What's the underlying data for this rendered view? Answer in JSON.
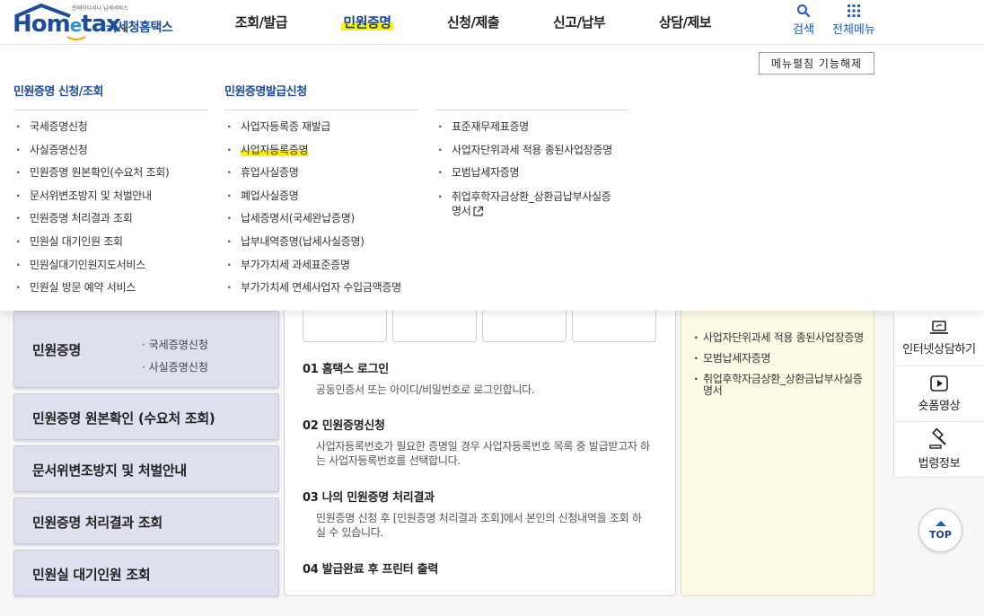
{
  "header": {
    "logo": {
      "tagline": "언제어디서나 납세서비스",
      "wordmark_home": "Hom",
      "wordmark_e": "e",
      "wordmark_tax": "tax",
      "wordmark_dot": ".",
      "subtitle": "국세청홈택스"
    },
    "nav": [
      {
        "label": "조회/발급"
      },
      {
        "label": "민원증명"
      },
      {
        "label": "신청/제출"
      },
      {
        "label": "신고/납부"
      },
      {
        "label": "상담/제보"
      }
    ],
    "search_label": "검색",
    "all_menu_label": "전체메뉴"
  },
  "mega_menu": {
    "unfix_button": "메뉴펼침 기능해제",
    "col1": {
      "title": "민원증명 신청/조회",
      "items": [
        "국세증명신청",
        "사실증명신청",
        "민원증명 원본확인(수요처 조회)",
        "문서위변조방지 및 처벌안내",
        "민원증명 처리결과 조회",
        "민원실 대기인원 조회",
        "민원실대기인원지도서비스",
        "민원실 방문 예약 서비스"
      ]
    },
    "col2": {
      "title": "민원증명발급신청",
      "items": [
        "사업자등록증 재발급",
        "사업자등록증명",
        "휴업사실증명",
        "폐업사실증명",
        "납세증명서(국세완납증명)",
        "납부내역증명(납세사실증명)",
        "부가가치세 과세표준증명",
        "부가가치세 면세사업자 수입금액증명"
      ]
    },
    "col3": {
      "items": [
        "표준재무제표증명",
        "사업자단위과세 적용 종된사업장증명",
        "모범납세자증명",
        "취업후학자금상환_상환금납부사실증",
        "명서"
      ]
    }
  },
  "page": {
    "side_menu": {
      "item1": "민원증명",
      "item1_subs": [
        "국세증명신청",
        "사실증명신청"
      ],
      "item2": "민원증명 원본확인 (수요처 조회)",
      "item3": "문서위변조방지 및 처벌안내",
      "item4": "민원증명 처리결과 조회",
      "item5": "민원실 대기인원 조회"
    },
    "steps": [
      {
        "title": "01 홈택스 로그인",
        "desc": "공동인증서 또는 아이디/비밀번호로 로그인합니다."
      },
      {
        "title": "02 민원증명신청",
        "desc": "사업자등록번호가 필요한 증명일 경우 사업자등록번호 목록 중 발급받고자 하는 사업자등록번호를 선택합니다."
      },
      {
        "title": "03 나의 민원증명 처리결과",
        "desc": "민원증명 신청 후 [민원증명 처리결과 조회]에서 본인의 신청내역을 조회 하실 수 있습니다."
      },
      {
        "title": "04 발급완료 후 프린터 출력",
        "desc": ""
      }
    ],
    "right_list": [
      "사업자단위과세 적용 종된사업장증명",
      "모범납세자증명",
      "취업후학자금상환_상환금납부사실증명서"
    ],
    "quick_menu": {
      "internet_consult": "인터넷상담하기",
      "shorts_video": "숏폼영상",
      "law_info": "법령정보",
      "top": "TOP"
    }
  },
  "colors": {
    "brand_blue": "#1f4c9c",
    "highlight_yellow": "#fff200",
    "side_box_bg": "#dfe0ee",
    "right_panel_bg": "#fdfbe6"
  },
  "icons": [
    "search-icon",
    "grid-menu-icon",
    "external-link-icon",
    "laptop-icon",
    "play-icon",
    "gavel-icon",
    "arrow-up-icon"
  ]
}
